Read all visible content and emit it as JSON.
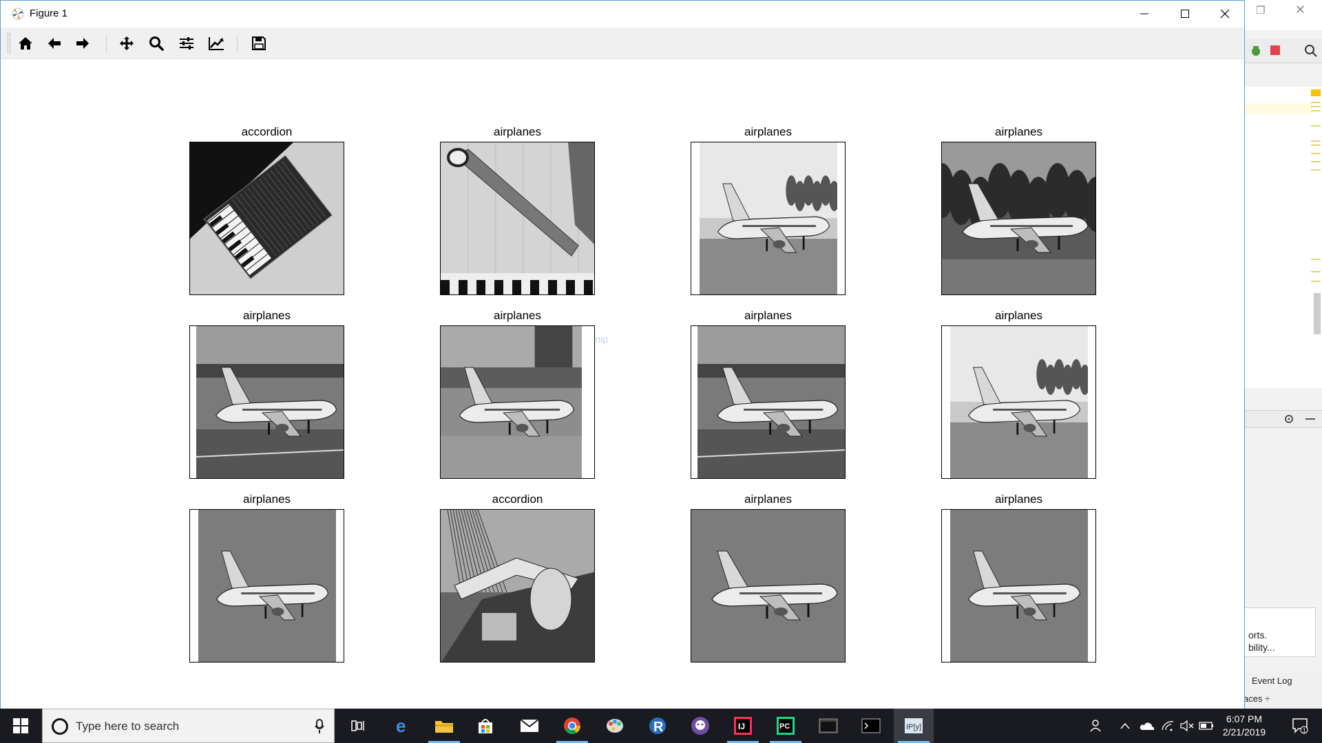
{
  "window": {
    "title": "Figure 1",
    "minimize_icon": "minimize-icon",
    "maximize_icon": "maximize-icon",
    "close_icon": "close-icon"
  },
  "toolbar": {
    "buttons": [
      {
        "name": "home-icon"
      },
      {
        "name": "back-arrow-icon"
      },
      {
        "name": "forward-arrow-icon"
      },
      {
        "name": "pan-icon"
      },
      {
        "name": "zoom-icon"
      },
      {
        "name": "configure-subplots-icon"
      },
      {
        "name": "edit-axis-icon"
      },
      {
        "name": "save-icon"
      }
    ]
  },
  "figure": {
    "grid": {
      "rows": 3,
      "cols": 4
    },
    "subplots": [
      {
        "title": "accordion",
        "scene": "accordion"
      },
      {
        "title": "airplanes",
        "scene": "wing"
      },
      {
        "title": "airplanes",
        "scene": "plane-ground",
        "pad": "left-right"
      },
      {
        "title": "airplanes",
        "scene": "plane-trees"
      },
      {
        "title": "airplanes",
        "scene": "plane-tarmac",
        "pad": "left"
      },
      {
        "title": "airplanes",
        "scene": "plane-gate",
        "pad": "right"
      },
      {
        "title": "airplanes",
        "scene": "plane-tarmac",
        "pad": "left"
      },
      {
        "title": "airplanes",
        "scene": "plane-ground",
        "pad": "left-right"
      },
      {
        "title": "airplanes",
        "scene": "plane-sky",
        "pad": "left-right"
      },
      {
        "title": "accordion",
        "scene": "sculpture"
      },
      {
        "title": "airplanes",
        "scene": "plane-sky"
      },
      {
        "title": "airplanes",
        "scene": "plane-sky",
        "pad": "left-right"
      }
    ]
  },
  "overlay": {
    "snip_text": "Screen Snip"
  },
  "ide": {
    "notification_line1": "orts.",
    "notification_line2": "bility...",
    "event_log": "Event Log",
    "status_text": "aces ÷"
  },
  "taskbar": {
    "search_placeholder": "Type here to search",
    "apps": [
      {
        "name": "task-view-icon"
      },
      {
        "name": "edge-icon"
      },
      {
        "name": "file-explorer-icon"
      },
      {
        "name": "store-icon"
      },
      {
        "name": "mail-icon"
      },
      {
        "name": "chrome-icon"
      },
      {
        "name": "paint-icon"
      },
      {
        "name": "r-icon"
      },
      {
        "name": "github-icon"
      },
      {
        "name": "intellij-icon"
      },
      {
        "name": "pycharm-icon"
      },
      {
        "name": "terminal-icon"
      },
      {
        "name": "cmd-icon"
      },
      {
        "name": "ipython-icon"
      }
    ],
    "time": "6:07 PM",
    "date": "2/21/2019",
    "notification_count": "1"
  },
  "colors": {
    "taskbar_bg": "#1a1b20",
    "toolbar_bg": "#f0f0f0",
    "window_border": "#5b9bd5"
  }
}
